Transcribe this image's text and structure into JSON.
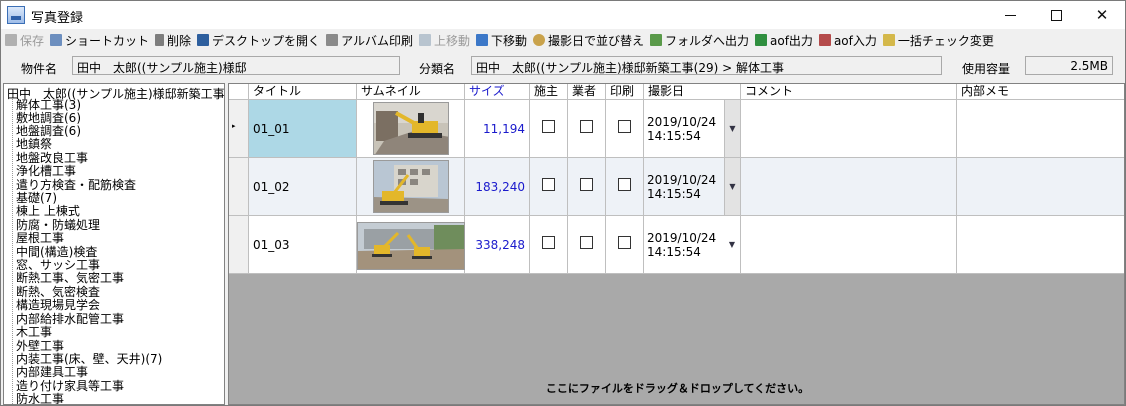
{
  "window": {
    "title": "写真登録"
  },
  "toolbar": {
    "save": "保存",
    "shortcut": "ショートカット",
    "delete": "削除",
    "open_desktop": "デスクトップを開く",
    "album_print": "アルバム印刷",
    "move_up": "上移動",
    "move_down": "下移動",
    "sort_date": "撮影日で並び替え",
    "export_folder": "フォルダへ出力",
    "aof_out": "aof出力",
    "aof_in": "aof入力",
    "bulk_check": "一括チェック変更"
  },
  "info": {
    "property_label": "物件名",
    "property_value": "田中　太郎((サンプル施主)様邸",
    "category_label": "分類名",
    "category_value": "田中　太郎((サンプル施主)様邸新築工事(29) > 解体工事",
    "usage_label": "使用容量",
    "usage_value": "2.5MB"
  },
  "tree": {
    "root": "田中　太郎((サンプル施主)様邸新築工事(2",
    "items": [
      "解体工事(3)",
      "敷地調査(6)",
      "地盤調査(6)",
      "地鎮祭",
      "地盤改良工事",
      "浄化槽工事",
      "遣り方検査・配筋検査",
      "基礎(7)",
      "棟上 上棟式",
      "防腐・防蟻処理",
      "屋根工事",
      "中間(構造)検査",
      "窓、サッシ工事",
      "断熱工事、気密工事",
      "断熱、気密検査",
      "構造現場見学会",
      "内部給排水配管工事",
      "木工事",
      "外壁工事",
      "内装工事(床、壁、天井)(7)",
      "内部建具工事",
      "造り付け家具等工事",
      "防水工事"
    ]
  },
  "grid": {
    "columns": {
      "title": "タイトル",
      "thumbnail": "サムネイル",
      "size": "サイズ",
      "owner": "施主",
      "contractor": "業者",
      "print": "印刷",
      "date": "撮影日",
      "comment": "コメント",
      "memo": "内部メモ"
    },
    "rows": [
      {
        "title": "01_01",
        "size": "11,194",
        "date": "2019/10/24",
        "time": "14:15:54"
      },
      {
        "title": "01_02",
        "size": "183,240",
        "date": "2019/10/24",
        "time": "14:15:54"
      },
      {
        "title": "01_03",
        "size": "338,248",
        "date": "2019/10/24",
        "time": "14:15:54"
      }
    ],
    "drop_hint": "ここにファイルをドラッグ＆ドロップしてください。"
  }
}
